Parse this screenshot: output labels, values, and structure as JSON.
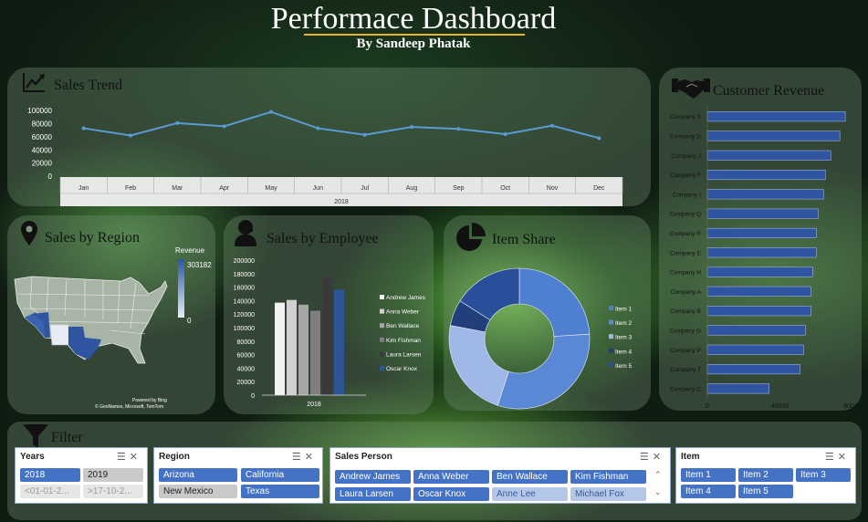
{
  "header": {
    "title": "Performace Dashboard",
    "subtitle": "By Sandeep Phatak"
  },
  "sales_trend": {
    "title": "Sales Trend",
    "icon": "line-chart-icon"
  },
  "customer_revenue": {
    "title": "Customer Revenue",
    "icon": "handshake-icon"
  },
  "sales_by_region": {
    "title": "Sales by Region",
    "icon": "map-pin-icon",
    "legend_title": "Revenue",
    "legend_max": "303182",
    "legend_min": "0",
    "attribution1": "Powered by Bing",
    "attribution2": "© GeoNames, Microsoft, TomTom"
  },
  "sales_by_employee": {
    "title": "Sales by Employee",
    "icon": "person-icon"
  },
  "item_share": {
    "title": "Item Share",
    "icon": "pie-icon"
  },
  "filter": {
    "label": "Filter",
    "icon": "funnel-icon",
    "years": {
      "title": "Years",
      "items": [
        "2018",
        "2019",
        "<01-01-2...",
        ">17-10-2..."
      ]
    },
    "region": {
      "title": "Region",
      "items": [
        "Arizona",
        "California",
        "New Mexico",
        "Texas"
      ]
    },
    "sales_person": {
      "title": "Sales Person",
      "items": [
        "Andrew James",
        "Anna Weber",
        "Ben Wallace",
        "Kim Fishman",
        "Laura Larsen",
        "Oscar Knox",
        "Anne Lee",
        "Michael Fox"
      ]
    },
    "item": {
      "title": "Item",
      "items": [
        "Item 1",
        "Item 2",
        "Item 3",
        "Item 4",
        "Item 5"
      ]
    }
  },
  "colors": {
    "accent": "#4472c4",
    "line": "#5b9bd5",
    "title_underline": "#e8b520"
  },
  "chart_data": [
    {
      "type": "line",
      "name": "Sales Trend",
      "categories": [
        "Jan",
        "Feb",
        "Mar",
        "Apr",
        "May",
        "Jun",
        "Jul",
        "Aug",
        "Sep",
        "Oct",
        "Nov",
        "Dec"
      ],
      "group_label": "2018",
      "values": [
        73000,
        62000,
        81000,
        76000,
        98000,
        73000,
        63000,
        75000,
        72000,
        64000,
        77000,
        58000
      ],
      "yticks": [
        "100000",
        "80000",
        "60000",
        "40000",
        "20000",
        "0"
      ],
      "ylim": [
        0,
        110000
      ]
    },
    {
      "type": "bar",
      "orientation": "horizontal",
      "name": "Customer Revenue",
      "categories": [
        "Company S",
        "Company D",
        "Company J",
        "Company F",
        "Company I",
        "Company Q",
        "Company R",
        "Company E",
        "Company H",
        "Company A",
        "Company B",
        "Company G",
        "Company P",
        "Company T",
        "Company C"
      ],
      "values": [
        76000,
        73000,
        68000,
        65000,
        64000,
        61000,
        60000,
        60000,
        58000,
        57000,
        57000,
        54000,
        53000,
        51000,
        34000
      ],
      "xticks": [
        "0",
        "40000",
        "80000"
      ],
      "xlim": [
        0,
        88000
      ]
    },
    {
      "type": "bar",
      "name": "Sales by Employee",
      "categories": [
        "2018"
      ],
      "series": [
        {
          "name": "Andrew James",
          "values": [
            137000
          ],
          "color": "#f2f2f2"
        },
        {
          "name": "Anna Weber",
          "values": [
            141000
          ],
          "color": "#d0d0d0"
        },
        {
          "name": "Ben Wallace",
          "values": [
            134000
          ],
          "color": "#a6a6a6"
        },
        {
          "name": "Kim Fishman",
          "values": [
            125000
          ],
          "color": "#7f7f7f"
        },
        {
          "name": "Laura Larsen",
          "values": [
            176000
          ],
          "color": "#3a3a3a"
        },
        {
          "name": "Oscar Knox",
          "values": [
            156000
          ],
          "color": "#2f5597"
        }
      ],
      "yticks": [
        "200000",
        "180000",
        "160000",
        "140000",
        "120000",
        "100000",
        "80000",
        "60000",
        "40000",
        "20000",
        "0"
      ],
      "ylim": [
        0,
        200000
      ]
    },
    {
      "type": "pie",
      "donut": true,
      "name": "Item Share",
      "labels": [
        "Item 1",
        "Item 2",
        "Item 3",
        "Item 4",
        "Item 5"
      ],
      "values": [
        24,
        31,
        23,
        6,
        16
      ],
      "colors": [
        "#4f7fd1",
        "#5b88d4",
        "#9fb8e8",
        "#213f7a",
        "#2a4f9a"
      ]
    }
  ]
}
